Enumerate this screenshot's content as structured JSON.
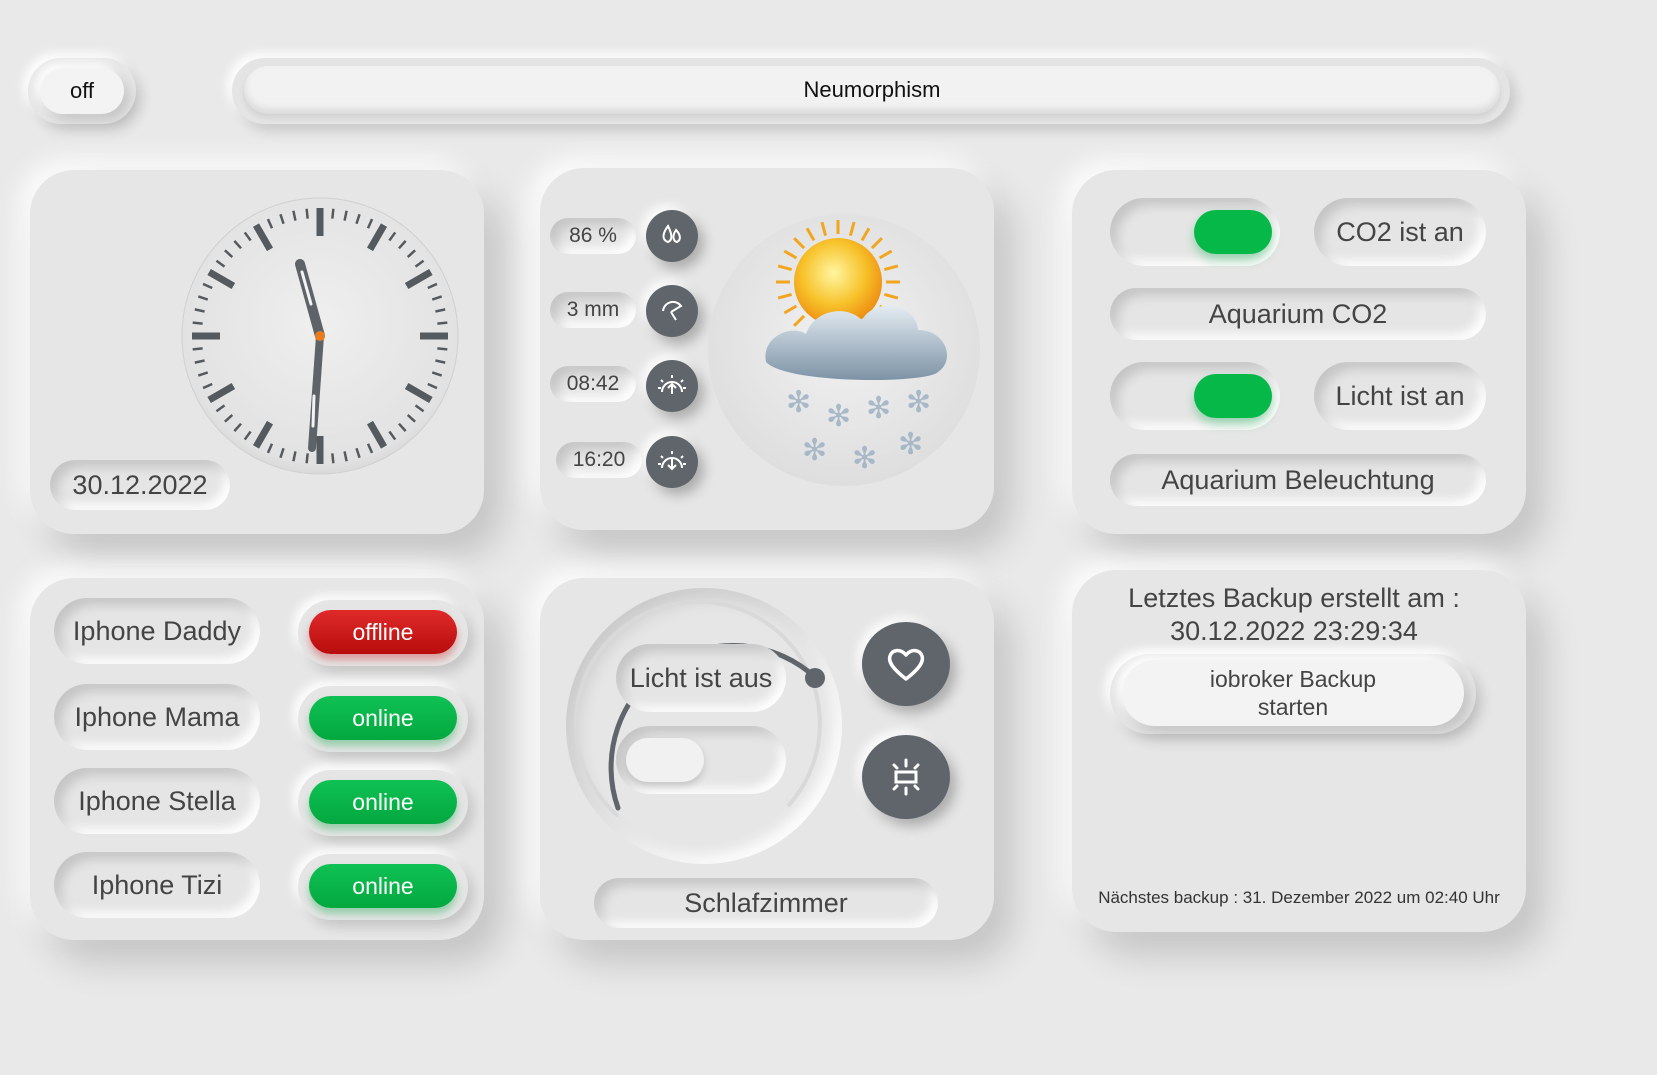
{
  "header": {
    "toggle_label": "off",
    "title": "Neumorphism"
  },
  "clock": {
    "time_shown": "11:31",
    "date": "30.12.2022"
  },
  "weather": {
    "humidity": "86 %",
    "rain": "3 mm",
    "sunrise": "08:42",
    "sunset": "16:20",
    "icons": [
      "droplets-icon",
      "umbrella-icon",
      "sunrise-icon",
      "sunset-icon"
    ],
    "condition_icon": "sun-cloud-snow-icon"
  },
  "aquarium": {
    "co2_state": "CO2 ist an",
    "co2_label": "Aquarium CO2",
    "light_state": "Licht ist an",
    "light_label": "Aquarium Beleuchtung",
    "co2_on": true,
    "light_on": true,
    "accent": "#05b848"
  },
  "presence": {
    "devices": [
      {
        "name": "Iphone Daddy",
        "status": "offline"
      },
      {
        "name": "Iphone Mama",
        "status": "online"
      },
      {
        "name": "Iphone Stella",
        "status": "online"
      },
      {
        "name": "Iphone Tizi",
        "status": "online"
      }
    ]
  },
  "bedroom": {
    "light_state": "Licht ist aus",
    "room": "Schlafzimmer",
    "light_on": false,
    "dimmer_level": 0,
    "icons": [
      "heart-icon",
      "ceiling-light-icon"
    ]
  },
  "backup": {
    "title_line1": "Letztes Backup erstellt am :",
    "title_line2": "30.12.2022 23:29:34",
    "button_line1": "iobroker Backup",
    "button_line2": "starten",
    "next": "Nächstes backup : 31. Dezember 2022 um 02:40 Uhr"
  },
  "colors": {
    "background": "#e9e9e9",
    "online": "#05b848",
    "offline": "#d01818",
    "icon_button": "#5f656b"
  }
}
